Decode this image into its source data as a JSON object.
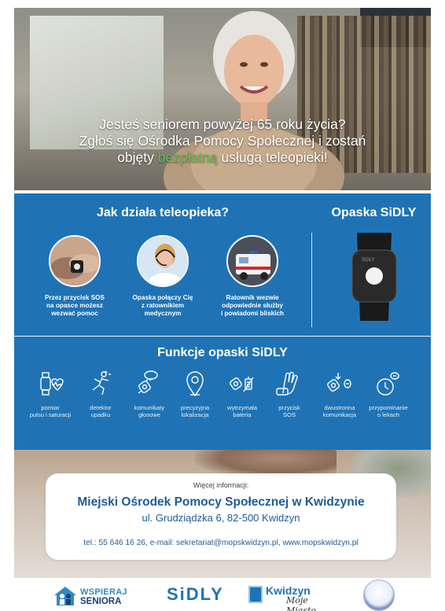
{
  "hero": {
    "line1": "Jesteś seniorem powyżej 65 roku życia?",
    "line2": "Zgłoś się Ośrodka Pomocy Społecznej i zostań",
    "line3_pre": "objęty ",
    "line3_free": "bezpłatną",
    "line3_post": " usługą teleopieki!"
  },
  "how": {
    "title": "Jak działa teleopieka?",
    "steps": [
      {
        "icon": "hand-band-photo",
        "line1": "Przez przycisk SOS",
        "line2": "na opasce możesz",
        "line3": "wezwać pomoc"
      },
      {
        "icon": "operator-headset-photo",
        "line1": "Opaska połączy Cię",
        "line2": "z ratownikiem",
        "line3": "medycznym"
      },
      {
        "icon": "ambulance-photo",
        "line1": "Ratownik wezwie",
        "line2": "odpowiednie służby",
        "line3": "i powiadomi bliskich"
      }
    ]
  },
  "band": {
    "title": "Opaska SiDLY"
  },
  "functions": {
    "title": "Funkcje opaski SiDLY",
    "items": [
      {
        "icon": "heart-pulse-icon",
        "line1": "pomiar",
        "line2": "pulsu i saturacji"
      },
      {
        "icon": "fall-detector-icon",
        "line1": "detektor",
        "line2": "upadku"
      },
      {
        "icon": "voice-message-icon",
        "line1": "komunikaty",
        "line2": "głosowe"
      },
      {
        "icon": "location-pin-icon",
        "line1": "precyzyjna",
        "line2": "lokalizacja"
      },
      {
        "icon": "battery-icon",
        "line1": "wytrzymała",
        "line2": "bateria"
      },
      {
        "icon": "sos-button-icon",
        "line1": "przycisk",
        "line2": "SOS"
      },
      {
        "icon": "two-way-call-icon",
        "line1": "dwustronna",
        "line2": "komunikacja"
      },
      {
        "icon": "medication-reminder-icon",
        "line1": "przypominanie",
        "line2": "o lekach"
      }
    ]
  },
  "info": {
    "more": "Więcej informacji:",
    "org": "Miejski Ośrodek Pomocy Społecznej w Kwidzynie",
    "address": "ul. Grudziądzka 6, 82-500 Kwidzyn",
    "contact": "tel.: 55 646 16 26,  e-mail: sekretariat@mopskwidzyn.pl,  www.mopskwidzyn.pl"
  },
  "logos": {
    "wspieraj_line1": "WSPIERAJ",
    "wspieraj_line2": "SENIORA",
    "sidly": "SiDLY",
    "kwidzyn": "Kwidzyn",
    "kwidzyn_tag": "Moje Miasto"
  },
  "colors": {
    "blue": "#1f73b5",
    "green_highlight": "#5fc248",
    "navy_text": "#1f5b94"
  }
}
